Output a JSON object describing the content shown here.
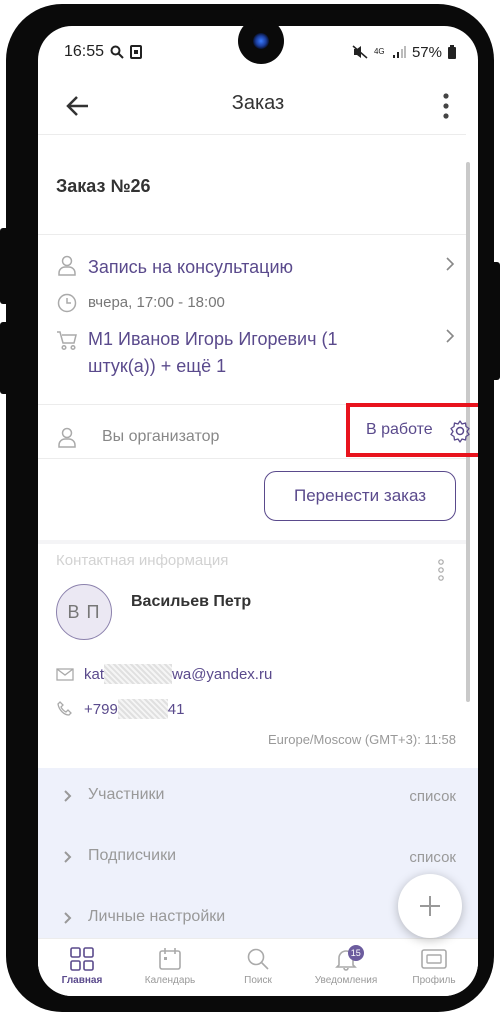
{
  "status_bar": {
    "time": "16:55",
    "network": "4G",
    "battery": "57%"
  },
  "app_bar": {
    "title": "Заказ"
  },
  "order": {
    "title": "Заказ №26",
    "service": "Запись на консультацию",
    "time": "вчера, 17:00 - 18:00",
    "items": "М1 Иванов Игорь Игоревич (1 штук(а)) + ещё 1",
    "organizer": "Вы организатор",
    "status": "В работе",
    "move_button": "Перенести заказ"
  },
  "contact": {
    "header": "Контактная информация",
    "initials": "В П",
    "name": "Васильев Петр",
    "email_start": "kat",
    "email_end": "wa@yandex.ru",
    "phone_start": "+799",
    "phone_end": "41",
    "timezone": "Europe/Moscow (GMT+3): 11:58"
  },
  "sections": [
    {
      "label": "Участники",
      "value": "список"
    },
    {
      "label": "Подписчики",
      "value": "список"
    },
    {
      "label": "Личные настройки",
      "value": ""
    }
  ],
  "bottom_nav": [
    {
      "label": "Главная",
      "icon": "grid-icon",
      "active": true
    },
    {
      "label": "Календарь",
      "icon": "calendar-icon"
    },
    {
      "label": "Поиск",
      "icon": "search-icon"
    },
    {
      "label": "Уведомления",
      "icon": "bell-icon",
      "badge": "15"
    },
    {
      "label": "Профиль",
      "icon": "profile-card-icon"
    }
  ],
  "colors": {
    "accent": "#5a4a8c",
    "highlight_border": "#e8131d",
    "section_bg": "#eef1fb"
  }
}
